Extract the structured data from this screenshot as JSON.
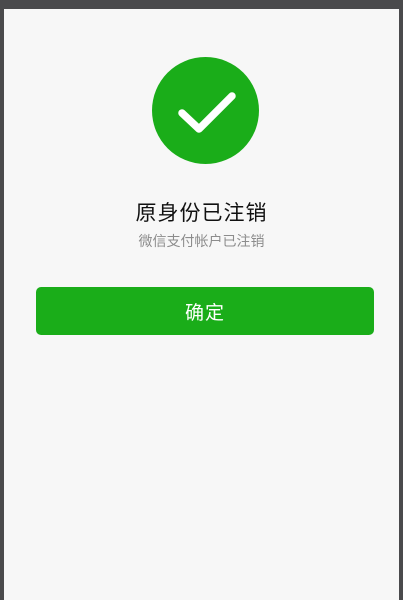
{
  "result": {
    "title": "原身份已注销",
    "subtitle": "微信支付帐户已注销",
    "icon": "check-circle-icon"
  },
  "actions": {
    "confirm_label": "确定"
  },
  "colors": {
    "primary_green": "#1aad19",
    "background": "#f7f7f7",
    "title_text": "#111111",
    "subtitle_text": "#8c8c8c"
  }
}
